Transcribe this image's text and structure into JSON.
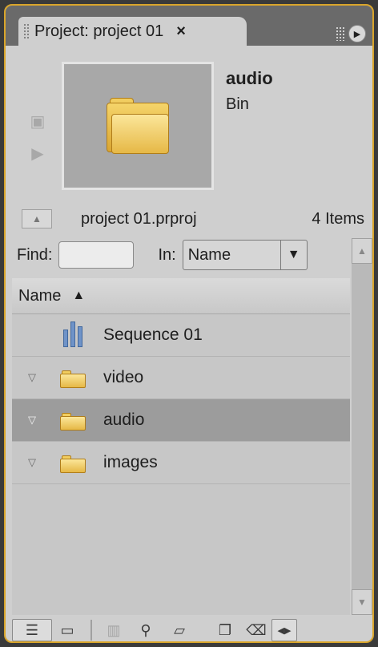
{
  "panel": {
    "tab_title": "Project: project 01",
    "close_glyph": "×",
    "menu_glyph": "▶"
  },
  "preview": {
    "item_name": "audio",
    "item_type": "Bin",
    "icon": "folder-icon"
  },
  "stats": {
    "project_file": "project 01.prproj",
    "item_count": "4 Items"
  },
  "find": {
    "label": "Find:",
    "value": "",
    "in_label": "In:",
    "in_selected": "Name",
    "arrow_glyph": "▼"
  },
  "list": {
    "header": "Name",
    "sort_glyph": "▲",
    "rows": [
      {
        "label": "Sequence 01",
        "type": "sequence",
        "twisty": ""
      },
      {
        "label": "video",
        "type": "bin",
        "twisty": "▽"
      },
      {
        "label": "audio",
        "type": "bin",
        "twisty": "▽",
        "selected": true
      },
      {
        "label": "images",
        "type": "bin",
        "twisty": "▽"
      }
    ]
  },
  "toolbar": {
    "list_view_glyph": "☰",
    "icon_view_glyph": "▭",
    "automate_glyph": "▥",
    "find_glyph": "⚲",
    "new_bin_glyph": "▱",
    "new_item_glyph": "❐",
    "delete_glyph": "⌫",
    "nav_glyph": "◀▶"
  },
  "colors": {
    "accent_border": "#d9a52b",
    "panel_bg": "#cfcfcf",
    "selected_row": "#9c9c9c"
  }
}
